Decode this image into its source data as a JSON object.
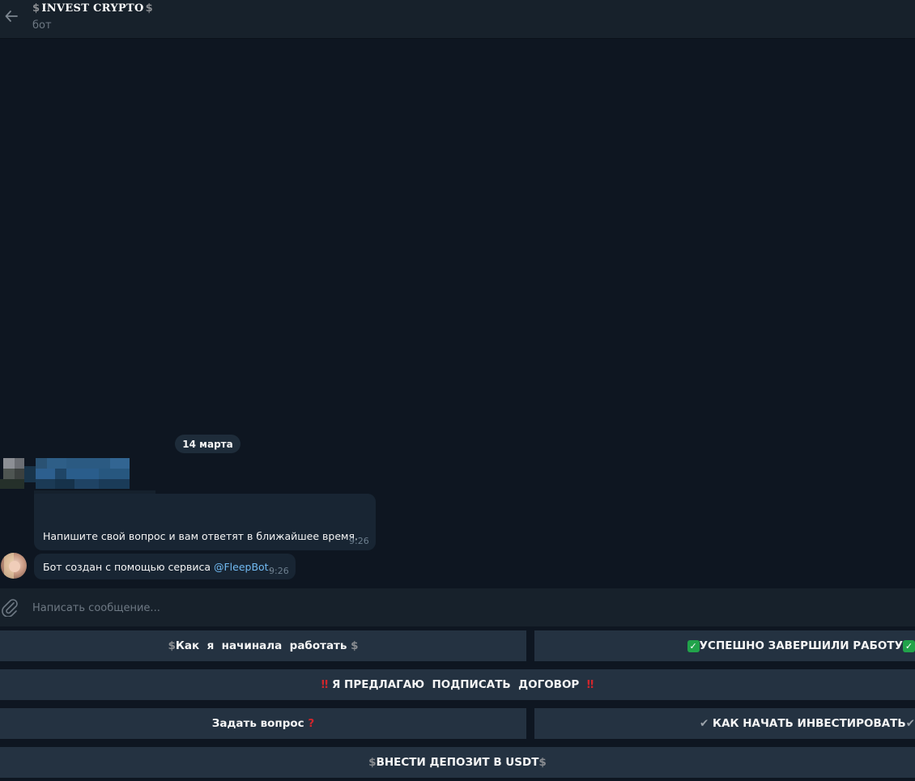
{
  "header": {
    "title": "INVEST CRYPTO",
    "subtitle": "бот"
  },
  "chat": {
    "date_label": "14 марта",
    "messages": [
      {
        "text": "Напишите свой вопрос и вам ответят в ближайшее время.",
        "time": "9:26"
      },
      {
        "text_prefix": "Бот создан с помощью сервиса ",
        "link": "@FleepBot",
        "text_suffix": ".",
        "time": "9:26"
      }
    ]
  },
  "input": {
    "placeholder": "Написать сообщение..."
  },
  "keyboard": {
    "buttons": [
      {
        "label": "Как  я  начинала  работать "
      },
      {
        "label": "УСПЕШНО ЗАВЕРШИЛИ РАБОТУ"
      },
      {
        "label": " Я ПРЕДЛАГАЮ  ПОДПИСАТЬ  ДОГОВОР  "
      },
      {
        "label": "Задать вопрос "
      },
      {
        "label": " КАК НАЧАТЬ ИНВЕСТИРОВАТЬ"
      },
      {
        "label": "ВНЕСТИ ДЕПОЗИТ В USDT"
      }
    ]
  },
  "icons": {
    "back": "arrow-left-icon",
    "attach": "paperclip-icon",
    "dollar": "heavy-dollar-sign-icon",
    "check": "check-mark-button-icon",
    "double_exclamation": "double-exclamation-icon",
    "question": "red-question-icon",
    "check_mark": "heavy-check-icon"
  },
  "colors": {
    "background": "#0e1621",
    "header": "#17212b",
    "bubble": "#182533",
    "button": "#243241",
    "link": "#71baf2"
  }
}
